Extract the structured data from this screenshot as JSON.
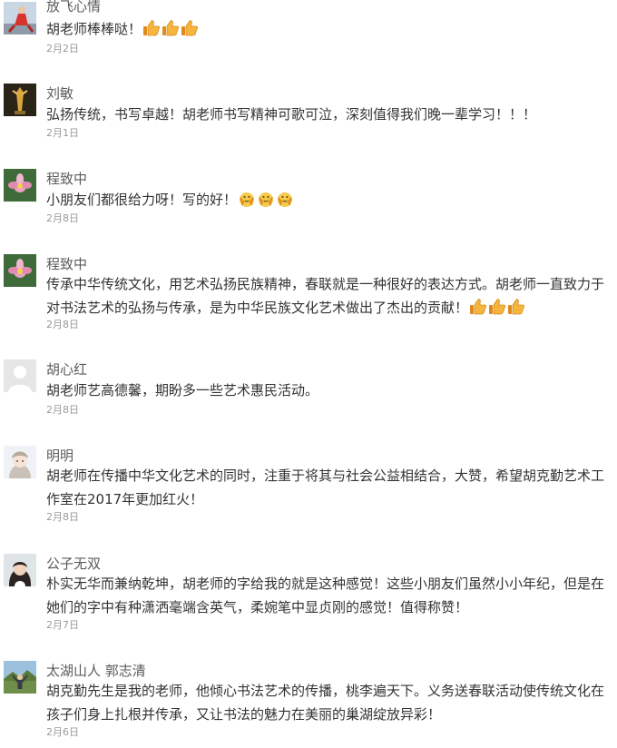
{
  "comments": [
    {
      "nickname": "放飞心情",
      "content": "胡老师棒棒哒！",
      "emojis": [
        "thumbs-up",
        "thumbs-up",
        "thumbs-up"
      ],
      "date": "2月2日",
      "avatar": "dancer-photo"
    },
    {
      "nickname": "刘敏",
      "content": "弘扬传统，书写卓越！胡老师书写精神可歌可泣，深刻值得我们晚一辈学习！！！",
      "emojis": [],
      "date": "2月1日",
      "avatar": "golden-statue-photo"
    },
    {
      "nickname": "程致中",
      "content": "小朋友们都很给力呀！写的好！",
      "emojis": [
        "applause",
        "applause",
        "applause"
      ],
      "date": "2月8日",
      "avatar": "lotus-flower-photo"
    },
    {
      "nickname": "程致中",
      "content": "传承中华传统文化，用艺术弘扬民族精神，春联就是一种很好的表达方式。胡老师一直致力于对书法艺术的弘扬与传承，是为中华民族文化艺术做出了杰出的贡献！",
      "emojis": [
        "thumbs-up",
        "thumbs-up",
        "thumbs-up"
      ],
      "date": "2月8日",
      "avatar": "lotus-flower-photo"
    },
    {
      "nickname": "胡心红",
      "content": "胡老师艺高德馨，期盼多一些艺术惠民活动。",
      "emojis": [],
      "date": "2月8日",
      "avatar": "default-avatar"
    },
    {
      "nickname": "明明",
      "content": "胡老师在传播中华文化艺术的同时，注重于将其与社会公益相结合，大赞，希望胡克勤艺术工作室在2017年更加红火！",
      "emojis": [],
      "date": "2月8日",
      "avatar": "anime-girl-photo"
    },
    {
      "nickname": "公子无双",
      "content": "朴实无华而兼纳乾坤，胡老师的字给我的就是这种感觉！这些小朋友们虽然小小年纪，但是在她们的字中有种潇洒毫端含英气，柔婉笔中显贞刚的感觉！值得称赞！",
      "emojis": [],
      "date": "2月7日",
      "avatar": "woman-portrait-photo"
    },
    {
      "nickname": "太湖山人 郭志清",
      "content": "胡克勤先生是我的老师，他倾心书法艺术的传播，桃李遍天下。义务送春联活动使传统文化在孩子们身上扎根并传承，又让书法的魅力在美丽的巢湖绽放异彩！",
      "emojis": [],
      "date": "2月6日",
      "avatar": "man-landscape-photo"
    }
  ]
}
